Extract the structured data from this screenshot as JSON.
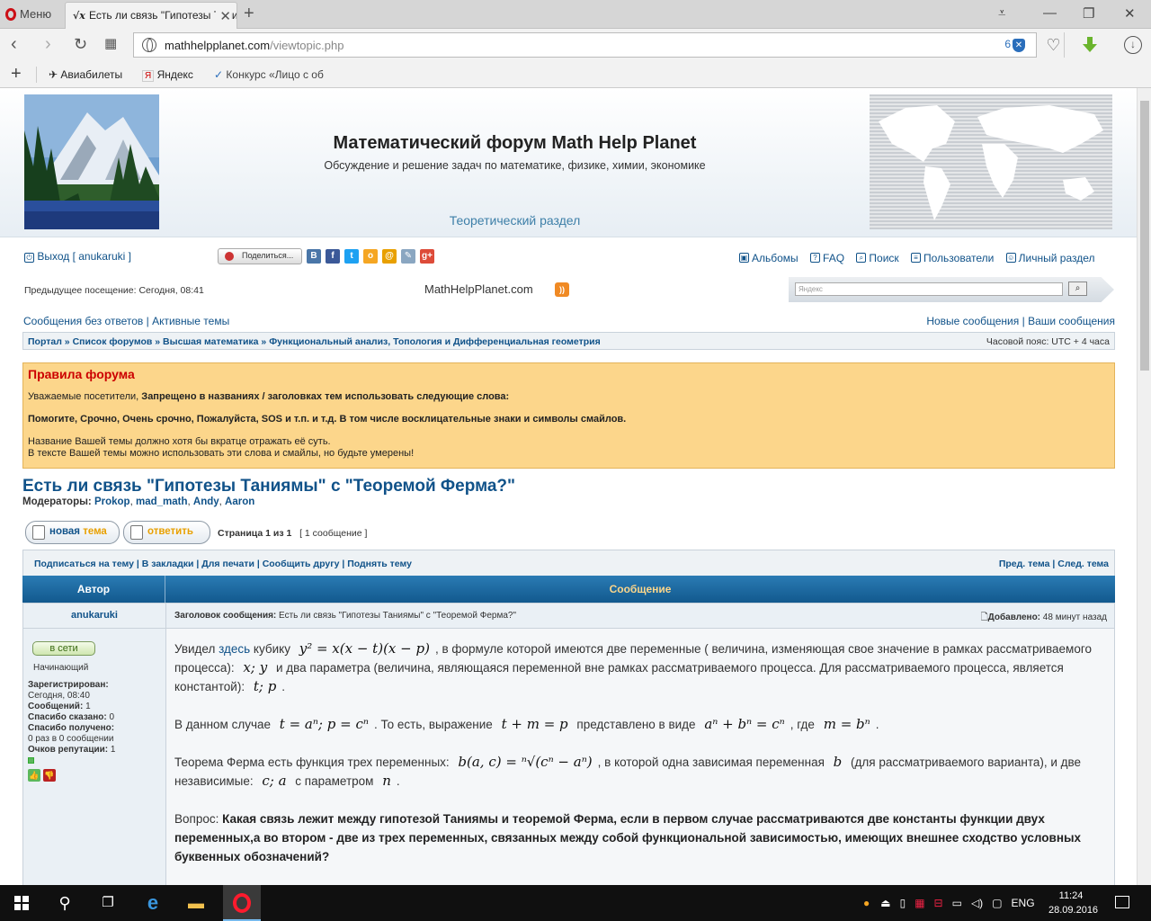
{
  "browser": {
    "menu_label": "Меню",
    "tab_title": "Есть ли связь \"Гипотезы Таниямы\" с \"Теоремой Ферма?\"",
    "url_domain": "mathhelpplanet.com",
    "url_path": "/viewtopic.php",
    "shield_count": "6",
    "bookmarks": [
      {
        "label": "Авиабилеты",
        "icon": "plane-icon"
      },
      {
        "label": "Яндекс",
        "icon": "yandex-icon"
      },
      {
        "label": "Конкурс «Лицо с об",
        "icon": "contest-icon"
      }
    ]
  },
  "header": {
    "title": "Математический форум Math Help Planet",
    "subtitle": "Обсуждение и решение задач по математике, физике, химии, экономике",
    "section": "Теоретический раздел"
  },
  "userbar": {
    "logout": "Выход [ anukaruki ]",
    "share": "Поделиться...",
    "links": [
      "Альбомы",
      "FAQ",
      "Поиск",
      "Пользователи",
      "Личный раздел"
    ],
    "prev_visit": "Предыдущее посещение: Сегодня, 08:41",
    "site_name": "MathHelpPlanet.com",
    "search_placeholder": "Яндекс"
  },
  "nav": {
    "unanswered": "Сообщения без ответов",
    "active": "Активные темы",
    "new_posts": "Новые сообщения",
    "your_posts": "Ваши сообщения",
    "breadcrumb": [
      "Портал",
      "Список форумов",
      "Высшая математика",
      "Функциональный анализ, Топология и Дифференциальная геометрия"
    ],
    "timezone": "Часовой пояс: UTC + 4 часа"
  },
  "rules": {
    "heading": "Правила форума",
    "line1_plain": "Уважаемые посетители, ",
    "line1_bold": "Запрещено в названиях / заголовках тем использовать следующие слова:",
    "line2": "Помогите, Срочно, Очень срочно, Пожалуйста, SOS и т.п. и т.д. В том числе восклицательные знаки и символы смайлов.",
    "line3": "Название Вашей темы должно хотя бы вкратце отражать её суть.",
    "line4": "В тексте Вашей темы можно использовать эти слова и смайлы, но будьте умерены!"
  },
  "topic": {
    "title": "Есть ли связь \"Гипотезы Таниямы\" с \"Теоремой Ферма?\"",
    "moderators_label": "Модераторы: ",
    "moderators": [
      "Prokop",
      "mad_math",
      "Andy",
      "Aaron"
    ],
    "new_topic_button": "новая тема",
    "new_topic_word1": "новая",
    "new_topic_word2": "тема",
    "reply_button": "ответить",
    "page_info": "Страница 1 из 1",
    "post_count": "[ 1 сообщение ]",
    "actions": [
      "Подписаться на тему",
      "В закладки",
      "Для печати",
      "Сообщить другу",
      "Поднять тему"
    ],
    "prev_topic": "Пред. тема",
    "next_topic": "След. тема"
  },
  "table": {
    "col_author": "Автор",
    "col_message": "Сообщение"
  },
  "post": {
    "author": "anukaruki",
    "subject_label": "Заголовок сообщения:",
    "subject": "Есть ли связь \"Гипотезы Таниямы\" с \"Теоремой Ферма?\"",
    "added_label": "Добавлено:",
    "added": "48 минут назад",
    "online": "в сети",
    "rank": "Начинающий",
    "registered_label": "Зарегистрирован:",
    "registered": "Сегодня, 08:40",
    "posts_label": "Сообщений:",
    "posts": "1",
    "thanks_said_label": "Спасибо сказано:",
    "thanks_said": "0",
    "thanks_got_label": "Спасибо получено:",
    "thanks_got": "0 раз в 0 сообщении",
    "rep_label": "Очков репутации:",
    "rep": "1",
    "p1_a": "Увидел ",
    "p1_link": "здесь",
    "p1_b": " кубику ",
    "p1_math1": "y² = x(x − t)(x − p)",
    "p1_c": ", в формуле которой имеются две переменные ( величина, изменяющая свое значение в рамках рассматриваемого процесса): ",
    "p1_math2": "x; y",
    "p1_d": " и два параметра (величина, являющаяся переменной вне рамках рассматриваемого процесса. Для рассматриваемого процесса, является константой): ",
    "p1_math3": "t; p",
    "p1_e": ".",
    "p2_a": "В данном случае ",
    "p2_math1": "t = aⁿ; p = cⁿ",
    "p2_b": ". То есть, выражение ",
    "p2_math2": "t + m = p",
    "p2_c": " представлено в виде ",
    "p2_math3": "aⁿ + bⁿ = cⁿ",
    "p2_d": ", где ",
    "p2_math4": "m = bⁿ",
    "p2_e": ".",
    "p3_a": "Теорема Ферма есть функция трех переменных: ",
    "p3_math1": "b(a, c) = ⁿ√(cⁿ − aⁿ)",
    "p3_b": ", в которой одна зависимая переменная ",
    "p3_math2": "b",
    "p3_c": " (для рассматриваемого варианта), и две независимые: ",
    "p3_math3": "c; a",
    "p3_d": " с параметром ",
    "p3_math4": "n",
    "p3_e": ".",
    "q_label": "Вопрос: ",
    "question": "Какая связь лежит между гипотезой Таниямы и теоремой Ферма, если в первом случае рассматриваются две константы функции двух переменных,а во втором - две из трех переменных, связанных между собой функциональной зависимостью, имеющих внешнее сходство условных буквенных обозначений?"
  },
  "taskbar": {
    "lang": "ENG",
    "time": "11:24",
    "date": "28.09.2016"
  }
}
